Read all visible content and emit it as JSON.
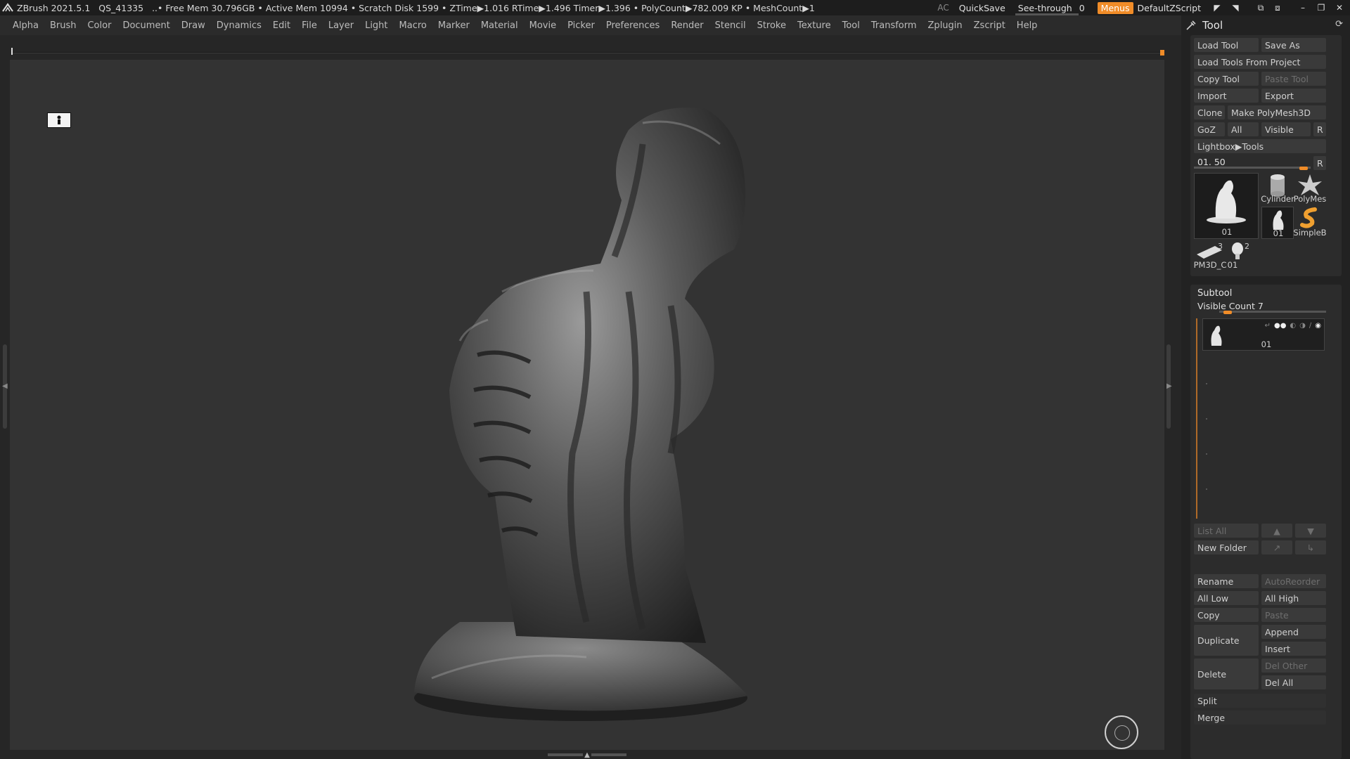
{
  "titlebar": {
    "app": "ZBrush 2021.5.1",
    "project": "QS_41335",
    "stats": "..• Free Mem 30.796GB • Active Mem 10994 • Scratch Disk 1599 •  ZTime▶1.016 RTime▶1.496 Timer▶1.396 • PolyCount▶782.009 KP  • MeshCount▶1",
    "ac": "AC",
    "quicksave": "QuickSave",
    "seethrough": "See-through",
    "seethrough_value": "0",
    "seethrough_level": 0.0,
    "menus": "Menus",
    "script": "DefaultZScript",
    "accent_color": "#f08c28"
  },
  "menubar": {
    "items": [
      "Alpha",
      "Brush",
      "Color",
      "Document",
      "Draw",
      "Dynamics",
      "Edit",
      "File",
      "Layer",
      "Light",
      "Macro",
      "Marker",
      "Material",
      "Movie",
      "Picker",
      "Preferences",
      "Render",
      "Stencil",
      "Stroke",
      "Texture",
      "Tool",
      "Transform",
      "Zplugin",
      "Zscript",
      "Help"
    ]
  },
  "palette": {
    "title": "Tool",
    "load_tool": "Load Tool",
    "save_as": "Save As",
    "load_from_project": "Load Tools From Project",
    "copy_tool": "Copy Tool",
    "paste_tool": "Paste Tool",
    "import": "Import",
    "export": "Export",
    "clone": "Clone",
    "make_polymesh": "Make PolyMesh3D",
    "goz": "GoZ",
    "all": "All",
    "visible": "Visible",
    "r": "R",
    "lightbox_tools": "Lightbox▶Tools",
    "tool_slider_label": "01. 50",
    "tool_slider_r": "R",
    "thumbnails": {
      "main": "01",
      "cylinder": "Cylinder",
      "polymesh": "PolyMes",
      "small01": "01",
      "simpleb": "SimpleB",
      "pm3d": "PM3D_C",
      "pm3d_count": "3",
      "head": "01",
      "head_count": "2"
    }
  },
  "subtool": {
    "title": "Subtool",
    "visible_count": "Visible Count 7",
    "item_name": "01",
    "list_all": "List All",
    "new_folder": "New Folder",
    "rename": "Rename",
    "autoreorder": "AutoReorder",
    "all_low": "All Low",
    "all_high": "All High",
    "copy": "Copy",
    "paste": "Paste",
    "duplicate": "Duplicate",
    "append": "Append",
    "insert": "Insert",
    "delete": "Delete",
    "del_other": "Del Other",
    "del_all": "Del All",
    "split": "Split",
    "merge": "Merge"
  }
}
